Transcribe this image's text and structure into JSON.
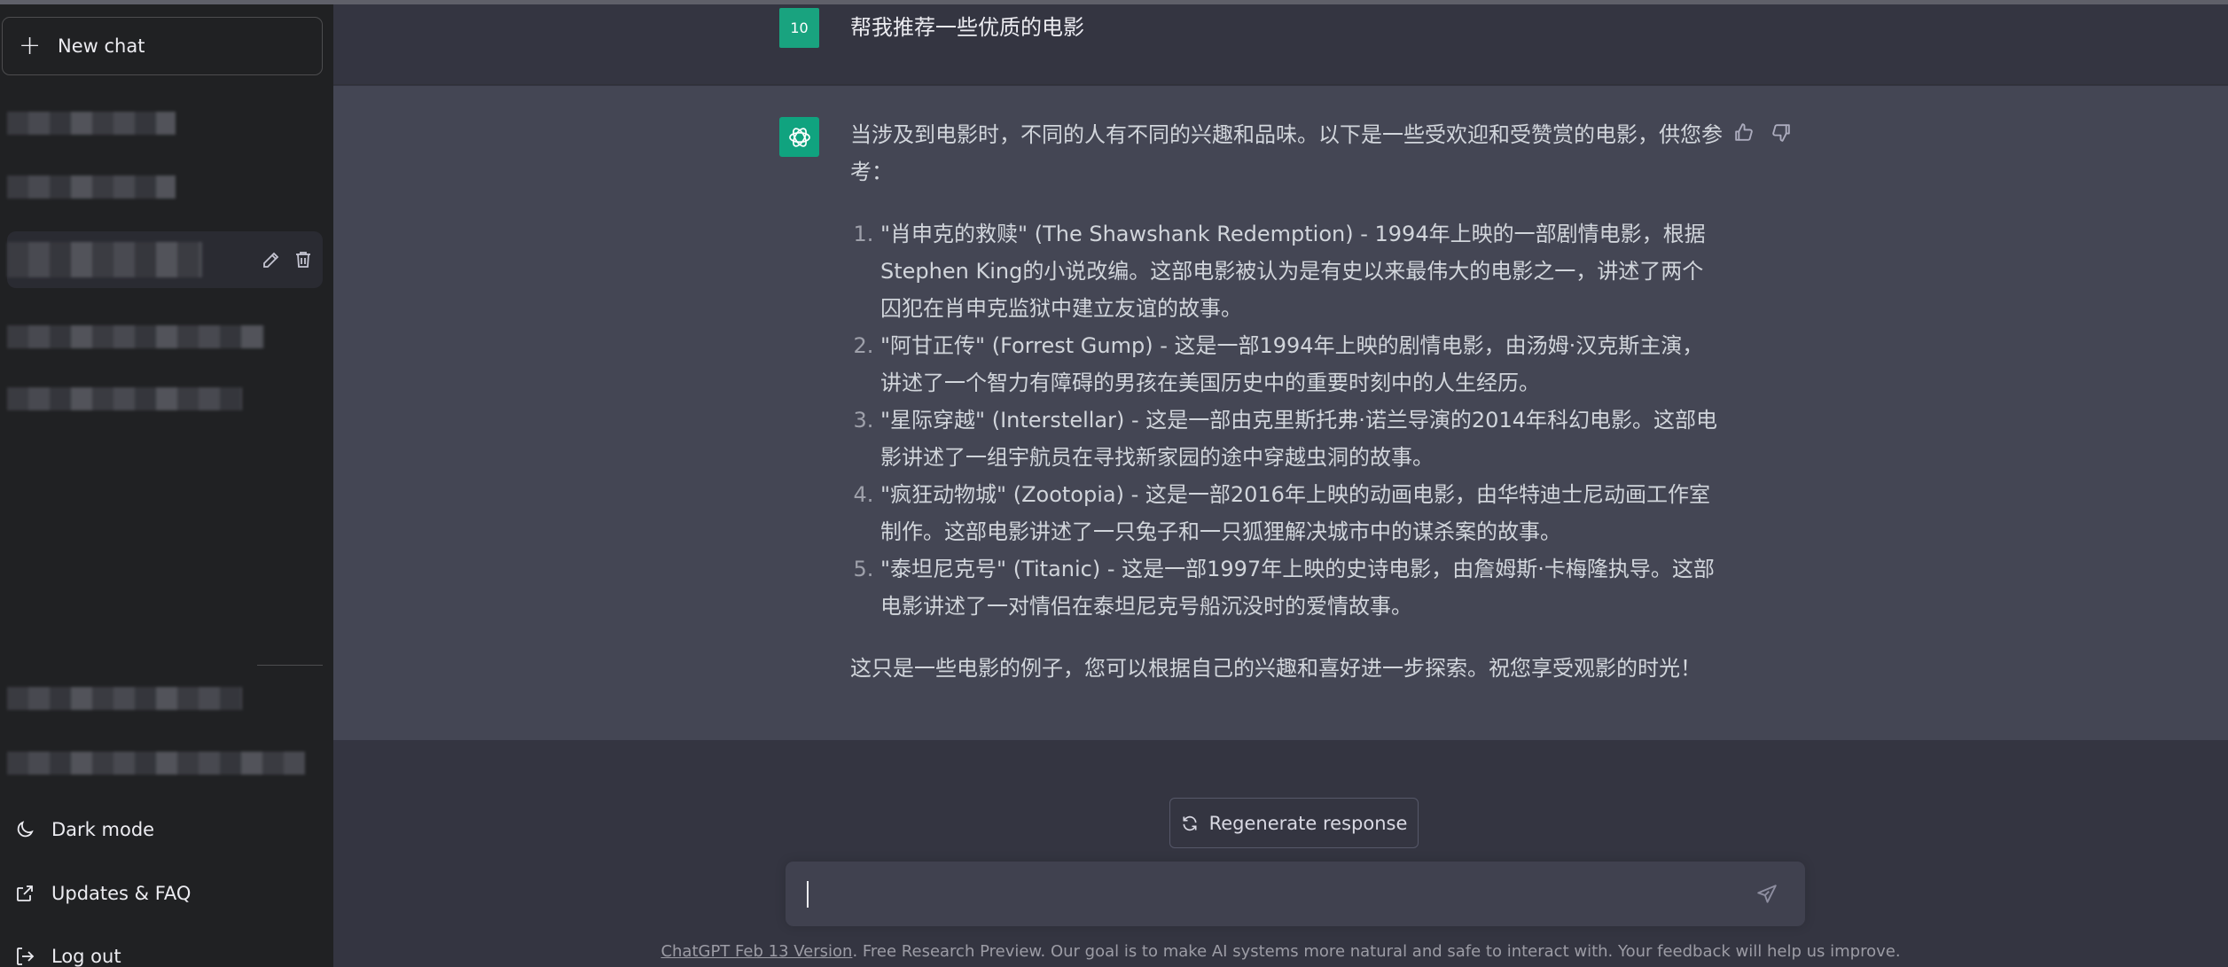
{
  "sidebar": {
    "new_chat_label": "New chat",
    "links": {
      "dark_mode": "Dark mode",
      "updates": "Updates & FAQ",
      "logout": "Log out"
    }
  },
  "conversation": {
    "user_avatar_text": "10",
    "user_message": "帮我推荐一些优质的电影",
    "assistant": {
      "intro": "当涉及到电影时，不同的人有不同的兴趣和品味。以下是一些受欢迎和受赞赏的电影，供您参考：",
      "items": [
        "\"肖申克的救赎\" (The Shawshank Redemption) - 1994年上映的一部剧情电影，根据Stephen King的小说改编。这部电影被认为是有史以来最伟大的电影之一，讲述了两个囚犯在肖申克监狱中建立友谊的故事。",
        "\"阿甘正传\" (Forrest Gump) - 这是一部1994年上映的剧情电影，由汤姆·汉克斯主演，讲述了一个智力有障碍的男孩在美国历史中的重要时刻中的人生经历。",
        "\"星际穿越\" (Interstellar) - 这是一部由克里斯托弗·诺兰导演的2014年科幻电影。这部电影讲述了一组宇航员在寻找新家园的途中穿越虫洞的故事。",
        "\"疯狂动物城\" (Zootopia) - 这是一部2016年上映的动画电影，由华特迪士尼动画工作室制作。这部电影讲述了一只兔子和一只狐狸解决城市中的谋杀案的故事。",
        "\"泰坦尼克号\" (Titanic) - 这是一部1997年上映的史诗电影，由詹姆斯·卡梅隆执导。这部电影讲述了一对情侣在泰坦尼克号船沉没时的爱情故事。"
      ],
      "outro": "这只是一些电影的例子，您可以根据自己的兴趣和喜好进一步探索。祝您享受观影的时光！"
    }
  },
  "regenerate_label": "Regenerate response",
  "composer": {
    "placeholder": ""
  },
  "footer": {
    "version_link": "ChatGPT Feb 13 Version",
    "text": ". Free Research Preview. Our goal is to make AI systems more natural and safe to interact with. Your feedback will help us improve."
  },
  "colors": {
    "sidebar_bg": "#202123",
    "main_bg": "#343541",
    "assistant_bg": "#444654",
    "accent": "#10a37f"
  }
}
